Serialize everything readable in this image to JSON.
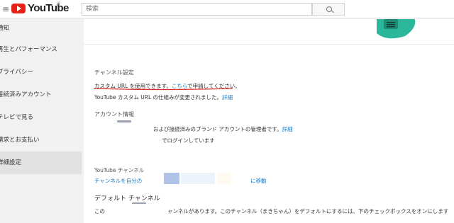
{
  "header": {
    "logo_text": "YouTube",
    "region_mark": "JP",
    "search_placeholder": "検索"
  },
  "sidebar": {
    "items": [
      {
        "label": "通知"
      },
      {
        "label": "再生とパフォーマンス"
      },
      {
        "label": "プライバシー"
      },
      {
        "label": "接続済みアカウント"
      },
      {
        "label": "テレビで見る"
      },
      {
        "label": "請求とお支払い"
      },
      {
        "label": "詳細設定"
      }
    ]
  },
  "channel_settings": {
    "title": "チャンネル設定",
    "custom_url_text": "カスタム URL を使用できます。",
    "custom_url_link": "こちら",
    "custom_url_suffix": "で申請してください。",
    "custom_url_note": "YouTube カスタム URL の仕組みが変更されました。",
    "custom_url_note_link": "詳細"
  },
  "account_info": {
    "title": "アカウント情報",
    "line1": "および接続済みのブランド アカウントの管理者です。",
    "line1_link": "詳細",
    "line2": "でログインしています"
  },
  "youtube_channel": {
    "title": "YouTube チャンネル",
    "move_prefix": "チャンネルを自分の",
    "move_suffix": "に移動"
  },
  "default_channel": {
    "title": "デフォルト チャンネル",
    "text_prefix": "この",
    "text": "ャンネルがあります。このチャンネル（まきちゃん）をデフォルトにするには、下のチェックボックスをオンにします"
  },
  "colors": {
    "link": "#167ac6",
    "logo_red": "#e62117",
    "underline": "#d93025",
    "graphic_teal": "#2bb89a"
  }
}
